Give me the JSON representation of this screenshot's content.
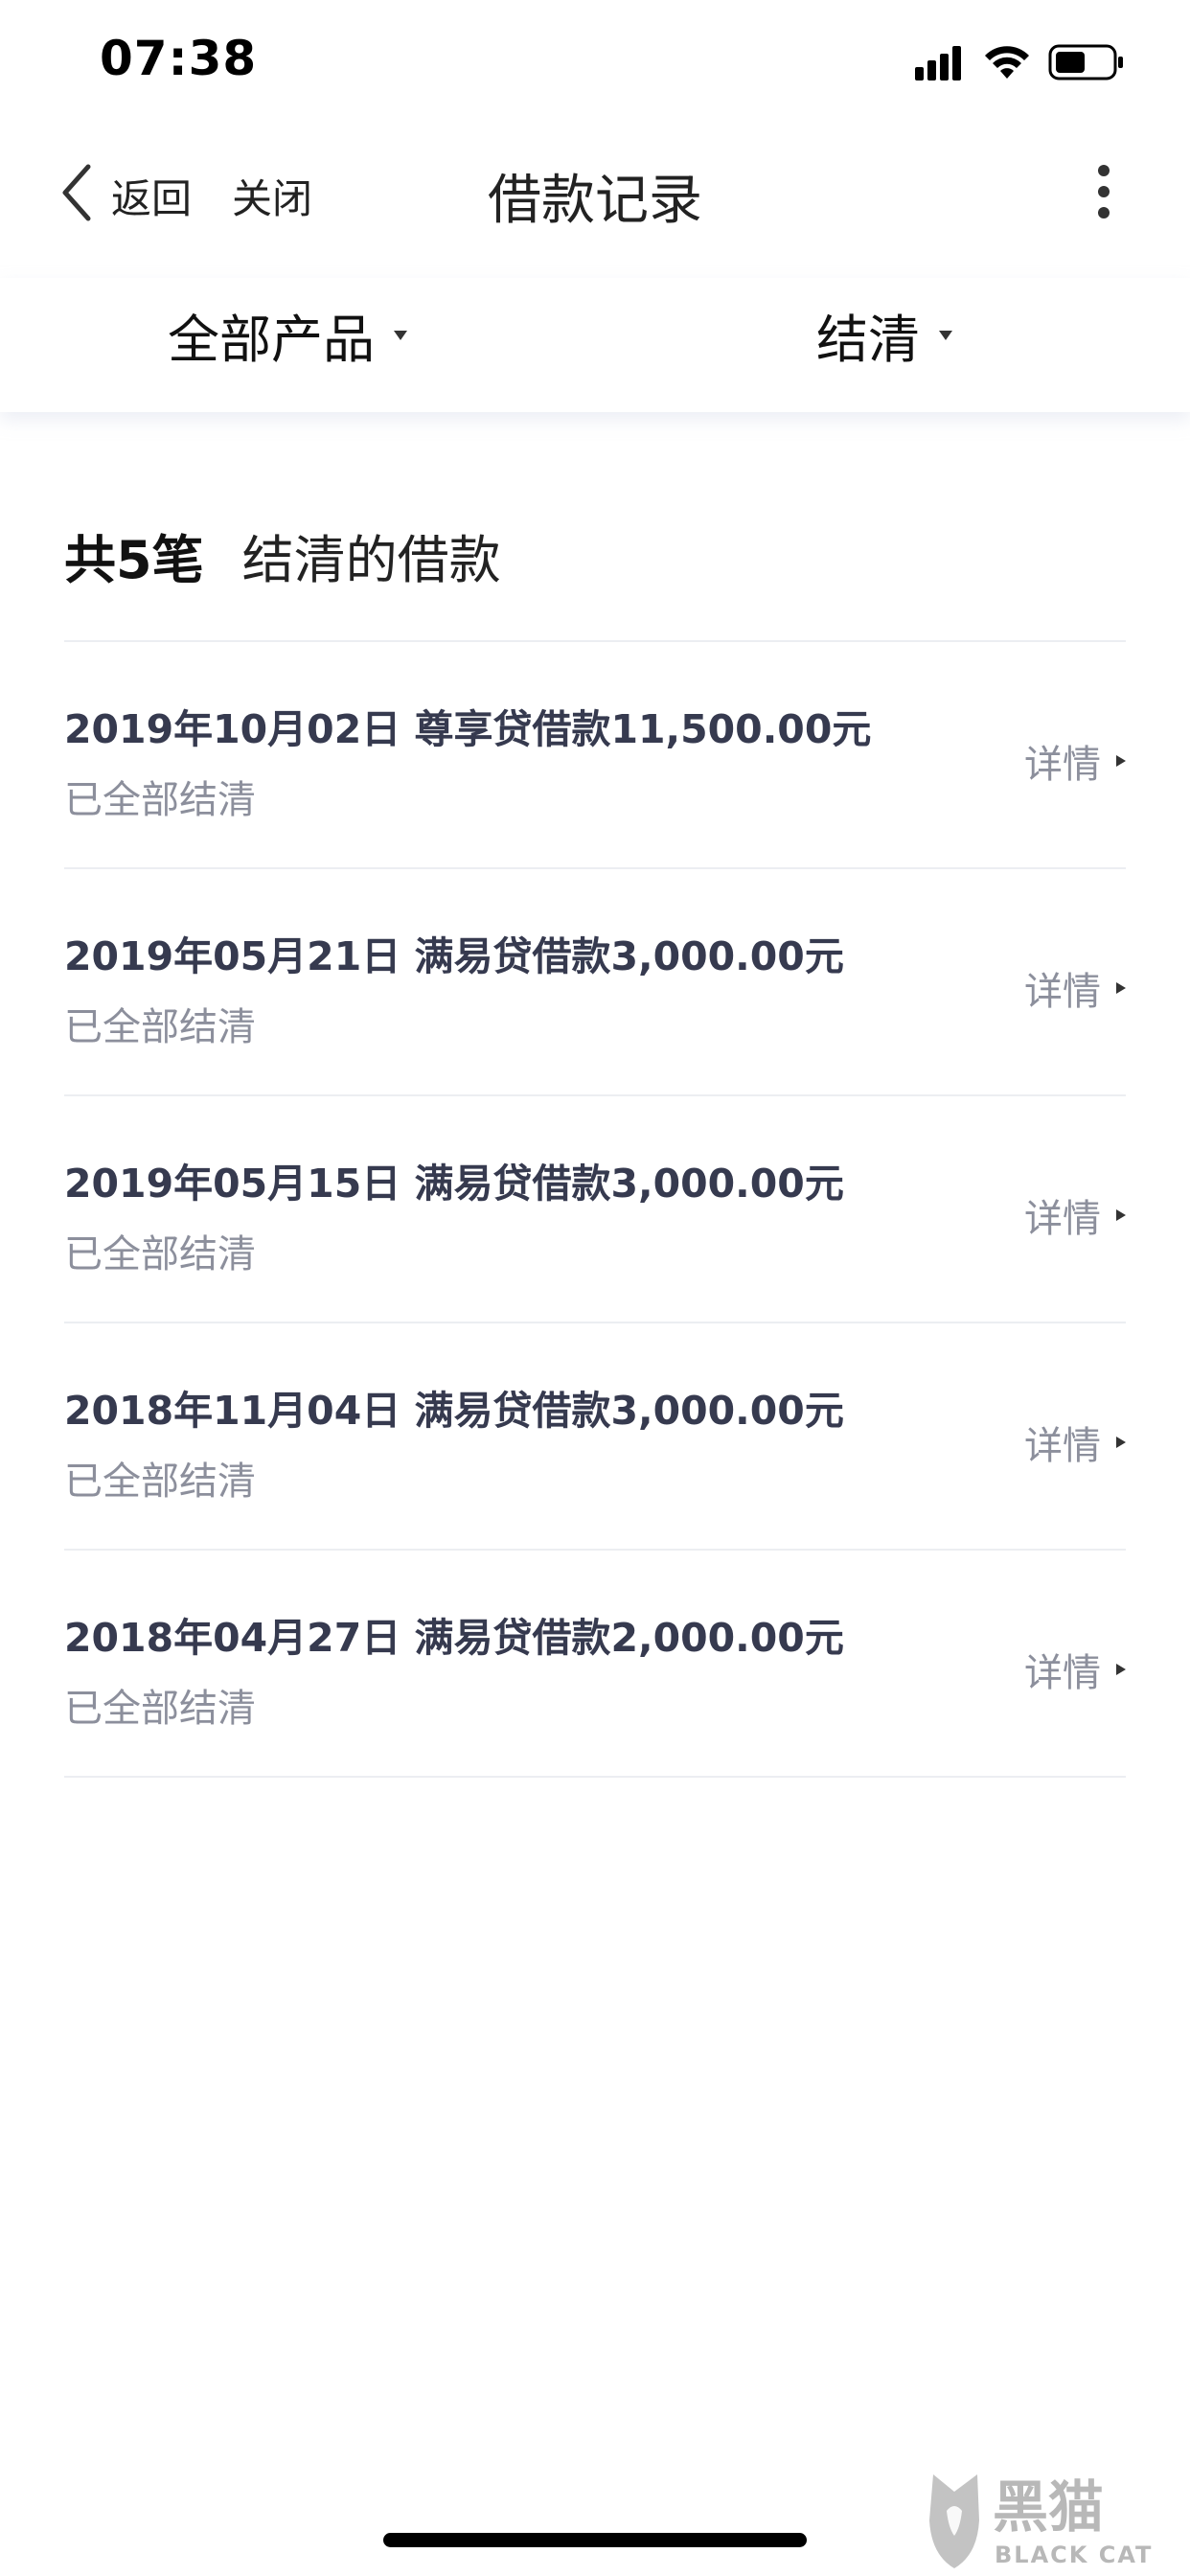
{
  "status_bar": {
    "time": "07:38"
  },
  "nav": {
    "back_label": "返回",
    "close_label": "关闭",
    "title": "借款记录"
  },
  "filters": {
    "product_label": "全部产品",
    "status_label": "结清"
  },
  "summary": {
    "count_label": "共5笔",
    "description": "结清的借款"
  },
  "loans": [
    {
      "title": "2019年10月02日 尊享贷借款11,500.00元",
      "status": "已全部结清",
      "detail_label": "详情"
    },
    {
      "title": "2019年05月21日 满易贷借款3,000.00元",
      "status": "已全部结清",
      "detail_label": "详情"
    },
    {
      "title": "2019年05月15日 满易贷借款3,000.00元",
      "status": "已全部结清",
      "detail_label": "详情"
    },
    {
      "title": "2018年11月04日 满易贷借款3,000.00元",
      "status": "已全部结清",
      "detail_label": "详情"
    },
    {
      "title": "2018年04月27日 满易贷借款2,000.00元",
      "status": "已全部结清",
      "detail_label": "详情"
    }
  ],
  "watermark": {
    "brand_cn": "黑猫",
    "brand_en": "BLACK CAT"
  },
  "icons": {
    "back": "chevron-left-icon",
    "more": "more-vertical-icon",
    "signal": "signal-icon",
    "wifi": "wifi-icon",
    "battery": "battery-icon",
    "filter_caret": "caret-down-icon",
    "detail_arrow": "caret-right-icon"
  }
}
